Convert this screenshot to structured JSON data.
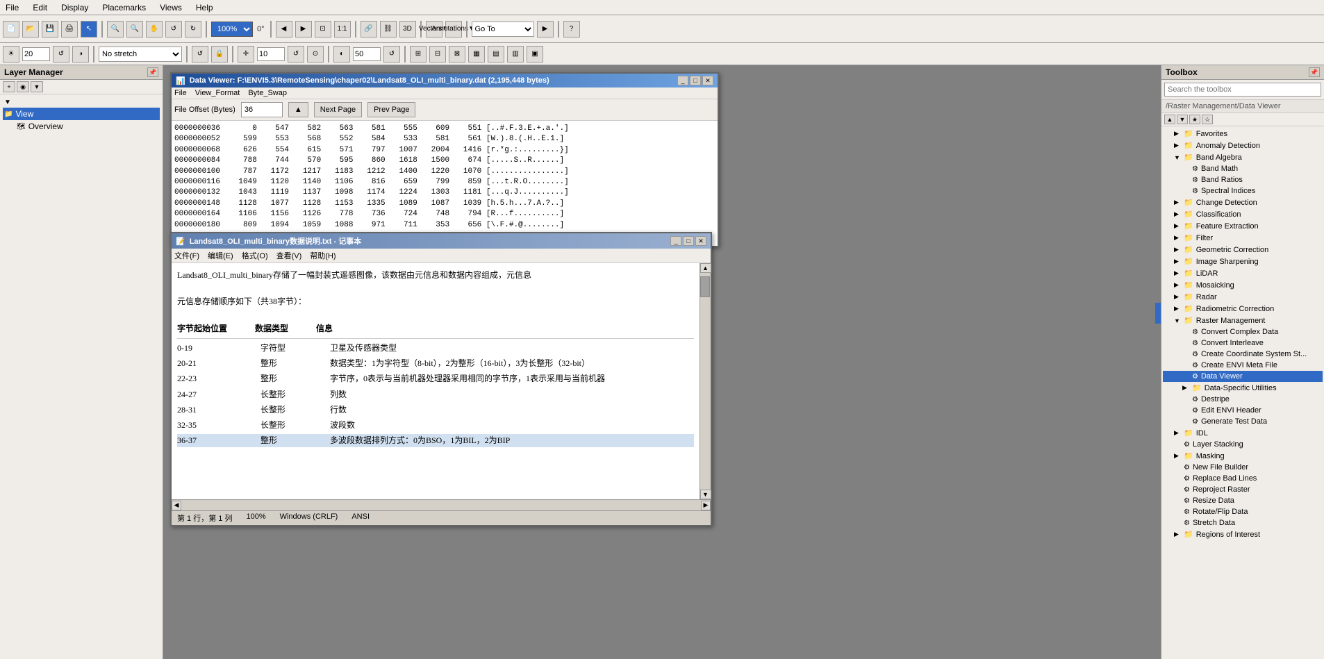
{
  "menu": {
    "items": [
      "File",
      "Edit",
      "Display",
      "Placemarks",
      "Views",
      "Help"
    ]
  },
  "toolbar1": {
    "zoom_value": "0°",
    "zoom2_value": "20",
    "zoom3_value": "10",
    "zoom4_value": "50",
    "stretch_label": "No stretch",
    "vectors_label": "Vectors",
    "annotations_label": "Annotations",
    "goto_label": "Go To"
  },
  "left_panel": {
    "title": "Layer Manager",
    "view_label": "View",
    "overview_label": "Overview"
  },
  "right_panel": {
    "title": "Toolbox",
    "search_placeholder": "Search the toolbox",
    "path": "/Raster Management/Data Viewer",
    "tree": [
      {
        "label": "Favorites",
        "level": 0,
        "type": "folder",
        "expanded": false
      },
      {
        "label": "Anomaly Detection",
        "level": 0,
        "type": "folder",
        "expanded": false
      },
      {
        "label": "Band Algebra",
        "level": 0,
        "type": "folder",
        "expanded": true
      },
      {
        "label": "Band Math",
        "level": 1,
        "type": "item"
      },
      {
        "label": "Band Ratios",
        "level": 1,
        "type": "item"
      },
      {
        "label": "Spectral Indices",
        "level": 1,
        "type": "item"
      },
      {
        "label": "Change Detection",
        "level": 0,
        "type": "folder",
        "expanded": false
      },
      {
        "label": "Classification",
        "level": 0,
        "type": "folder",
        "expanded": false
      },
      {
        "label": "Feature Extraction",
        "level": 0,
        "type": "folder",
        "expanded": false
      },
      {
        "label": "Filter",
        "level": 0,
        "type": "folder",
        "expanded": false
      },
      {
        "label": "Geometric Correction",
        "level": 0,
        "type": "folder",
        "expanded": false
      },
      {
        "label": "Image Sharpening",
        "level": 0,
        "type": "folder",
        "expanded": false
      },
      {
        "label": "LiDAR",
        "level": 0,
        "type": "folder",
        "expanded": false
      },
      {
        "label": "Mosaicking",
        "level": 0,
        "type": "folder",
        "expanded": false
      },
      {
        "label": "Radar",
        "level": 0,
        "type": "folder",
        "expanded": false
      },
      {
        "label": "Radiometric Correction",
        "level": 0,
        "type": "folder",
        "expanded": false
      },
      {
        "label": "Raster Management",
        "level": 0,
        "type": "folder",
        "expanded": true
      },
      {
        "label": "Convert Complex Data",
        "level": 1,
        "type": "item"
      },
      {
        "label": "Convert Interleave",
        "level": 1,
        "type": "item"
      },
      {
        "label": "Create Coordinate System St...",
        "level": 1,
        "type": "item"
      },
      {
        "label": "Create ENVI Meta File",
        "level": 1,
        "type": "item"
      },
      {
        "label": "Data Viewer",
        "level": 1,
        "type": "item",
        "active": true
      },
      {
        "label": "Data-Specific Utilities",
        "level": 1,
        "type": "folder"
      },
      {
        "label": "Destripe",
        "level": 1,
        "type": "item"
      },
      {
        "label": "Edit ENVI Header",
        "level": 1,
        "type": "item"
      },
      {
        "label": "Generate Test Data",
        "level": 1,
        "type": "item"
      },
      {
        "label": "IDL",
        "level": 0,
        "type": "folder",
        "expanded": false
      },
      {
        "label": "Layer Stacking",
        "level": 0,
        "type": "item"
      },
      {
        "label": "Masking",
        "level": 0,
        "type": "folder",
        "expanded": false
      },
      {
        "label": "New File Builder",
        "level": 0,
        "type": "item"
      },
      {
        "label": "Replace Bad Lines",
        "level": 0,
        "type": "item"
      },
      {
        "label": "Reproject Raster",
        "level": 0,
        "type": "item"
      },
      {
        "label": "Resize Data",
        "level": 0,
        "type": "item"
      },
      {
        "label": "Rotate/Flip Data",
        "level": 0,
        "type": "item"
      },
      {
        "label": "Stretch Data",
        "level": 0,
        "type": "item"
      },
      {
        "label": "Regions of Interest",
        "level": 0,
        "type": "folder",
        "expanded": false
      }
    ]
  },
  "data_viewer": {
    "title": "Data Viewer: F:\\ENVI5.3\\RemoteSensing\\chaper02\\Landsat8_OLI_multi_binary.dat (2,195,448 bytes)",
    "menu_items": [
      "File",
      "View_Format",
      "Byte_Swap"
    ],
    "offset_label": "File Offset (Bytes)",
    "offset_value": "36",
    "next_btn": "Next Page",
    "prev_btn": "Prev Page",
    "data_lines": [
      "0000000036       0    547    582    563    581    555    609    551 [..#.F.3.E.+.a.'.]",
      "0000000052     599    553    568    552    584    533    581    561 [W.).8.(.H..E.1.]",
      "0000000068     626    554    615    571    797   1007   2004   1416 [r.*g.:.........}]",
      "0000000084     788    744    570    595    860   1618   1500    674 [.....S..R......]",
      "0000000100     787   1172   1217   1183   1212   1400   1220   1070 [................]",
      "0000000116    1049   1120   1140   1106    816    659    799    859 [...t.R.O........]",
      "0000000132    1043   1119   1137   1098   1174   1224   1303   1181 [...q.J..........]",
      "0000000148    1128   1077   1128   1153   1335   1089   1087   1039 [h.5.h...7.A.?..]",
      "0000000164    1106   1156   1126    778    736    724    748    794 [R...f..........]",
      "0000000180     809   1094   1059   1088    971    711    353    656 [\\.F.#.@........]"
    ]
  },
  "notepad": {
    "title": "Landsat8_OLI_multi_binary数据说明.txt - 记事本",
    "menu_items": [
      "文件(F)",
      "编辑(E)",
      "格式(O)",
      "查看(V)",
      "帮助(H)"
    ],
    "content_intro": "Landsat8_OLI_multi_binary存储了一幅封装式遥感图像，该数据由元信息和数据内容组成，元信息",
    "content_meta": "元信息存储顺序如下（共38字节）：",
    "table_headers": [
      "字节起始位置",
      "数据类型",
      "信息"
    ],
    "table_rows": [
      [
        "0-19",
        "字符型",
        "卫星及传感器类型"
      ],
      [
        "20-21",
        "整形",
        "数据类型：1为字符型（8-bit），2为整形（16-bit），3为长整形（32-bit）"
      ],
      [
        "22-23",
        "整形",
        "字节序，0表示与当前机器处理器采用相同的字节序，1表示采用与当前机器"
      ],
      [
        "24-27",
        "长整形",
        "列数"
      ],
      [
        "28-31",
        "长整形",
        "行数"
      ],
      [
        "32-35",
        "长整形",
        "波段数"
      ],
      [
        "36-37",
        "整形",
        "多波段数据排列方式：0为BSO，1为BIL，2为BIP"
      ]
    ],
    "statusbar": {
      "position": "第 1 行，第 1 列",
      "zoom": "100%",
      "encoding": "Windows (CRLF)",
      "charset": "ANSI"
    }
  }
}
